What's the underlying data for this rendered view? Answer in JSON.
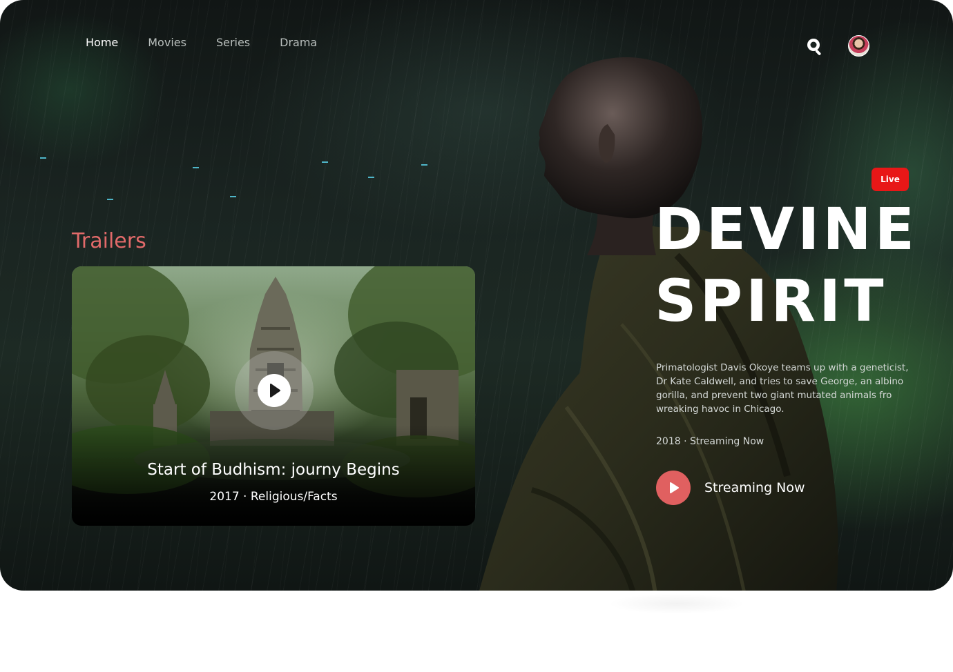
{
  "nav": {
    "items": [
      {
        "label": "Home",
        "active": true
      },
      {
        "label": "Movies",
        "active": false
      },
      {
        "label": "Series",
        "active": false
      },
      {
        "label": "Drama",
        "active": false
      }
    ]
  },
  "header": {
    "search_icon": "search-icon",
    "avatar_icon": "user-avatar"
  },
  "trailers": {
    "section_title": "Trailers",
    "card": {
      "title": "Start of Budhism: journy Begins",
      "meta": "2017 · Religious/Facts",
      "play_icon": "play-icon"
    }
  },
  "featured": {
    "badge": "Live",
    "title_line1": "DEVINE",
    "title_line2": "SPIRIT",
    "description": "Primatologist Davis Okoye teams up with a geneticist, Dr Kate Caldwell, and tries to save George, an albino gorilla, and prevent two giant mutated animals fro  wreaking havoc in Chicago.",
    "meta": "2018 · Streaming Now",
    "cta_label": "Streaming Now",
    "cta_icon": "play-icon"
  },
  "colors": {
    "accent": "#e26a6a",
    "live_badge": "#e81717",
    "cta": "#e06060",
    "text": "#ffffff"
  }
}
